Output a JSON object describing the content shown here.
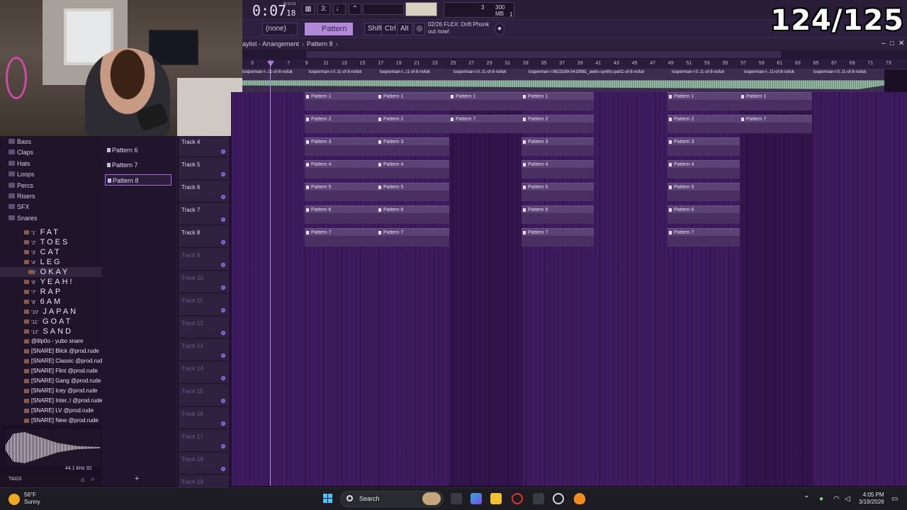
{
  "counter": "124/125",
  "toolbar": {
    "time_main": "0:07",
    "time_sub": "18",
    "time_label": "M:S:CS",
    "cpu_value": "3",
    "memory": "300 MB",
    "cpu_small": "1"
  },
  "bar2": {
    "none_label": "(none)",
    "pattern_label": "Pattern 8",
    "shift": "Shift",
    "ctrl": "Ctrl",
    "alt": "Alt",
    "news_line1": "02/26  FLEX: Drift Phonk",
    "news_line2": "out now!"
  },
  "playlist": {
    "title": "aylist - Arrangement",
    "current": "Pattern 8"
  },
  "ruler": [
    "3",
    "5",
    "7",
    "9",
    "11",
    "13",
    "15",
    "17",
    "19",
    "21",
    "23",
    "25",
    "27",
    "29",
    "31",
    "33",
    "35",
    "37",
    "39",
    "41",
    "43",
    "45",
    "47",
    "49",
    "51",
    "53",
    "55",
    "57",
    "59",
    "61",
    "63",
    "65",
    "67",
    "69",
    "71",
    "73"
  ],
  "audio_labels": [
    "looperman-l-..t1-of-8-nofuk",
    "looperman-l-0..t1-of-8-nofuk",
    "looperman-l-..t1-of-8-nofuk",
    "looperman-l-0..t1-of-8-nofuk",
    "looperman-l-0623169-0419981_awks-synths-part1-of-8-nofuk",
    "looperman-l-0..t1-of-8-nofuk",
    "looperman-l-..t1-of-8-nofuk",
    "looperman-l-0..t1-of-8-nofuk"
  ],
  "browser": {
    "folders": [
      "Bass",
      "Claps",
      "Hats",
      "Loops",
      "Percs",
      "Risers",
      "SFX",
      "Snares"
    ],
    "sounds": [
      {
        "num": "'1'",
        "name": "FAT"
      },
      {
        "num": "'2'",
        "name": "TOES"
      },
      {
        "num": "'3'",
        "name": "CAT"
      },
      {
        "num": "'4'",
        "name": "LEG"
      },
      {
        "num": "'5'",
        "name": "OKAY"
      },
      {
        "num": "'6'",
        "name": "YEAH!"
      },
      {
        "num": "'7'",
        "name": "RAP"
      },
      {
        "num": "'8'",
        "name": "6AM"
      },
      {
        "num": "'10'",
        "name": "JAPAN"
      },
      {
        "num": "'11'",
        "name": "GOAT"
      },
      {
        "num": "'12'",
        "name": "SAND"
      }
    ],
    "samples": [
      "@lilp0o - yubo snare",
      "[SNARE] Blick @prod.rude",
      "[SNARE] Classic @prod.rude",
      "[SNARE] Flint @prod.rude",
      "[SNARE] Gang @prod.rude",
      "[SNARE] Icey @prod.rude",
      "[SNARE] Inter..l @prod.rude",
      "[SNARE] LV @prod.rude",
      "[SNARE] New @prod.rude"
    ],
    "sample_info": "44.1 kHz 32",
    "tags": "TAGS"
  },
  "picker": [
    "Pattern 6",
    "Pattern 7",
    "Pattern 8"
  ],
  "tracks": [
    "Track 4",
    "Track 5",
    "Track 6",
    "Track 7",
    "Track 8",
    "Track 9",
    "Track 10",
    "Track 11",
    "Track 12",
    "Track 13",
    "Track 14",
    "Track 15",
    "Track 16",
    "Track 17",
    "Track 18",
    "Track 19"
  ],
  "clips": {
    "row1": "Pattern 1",
    "row2a": "Pattern 2",
    "row2b": "Pattern 7",
    "row3": "Pattern 3",
    "row4": "Pattern 4",
    "row5": "Pattern 5",
    "row6": "Pattern 6",
    "row7": "Pattern 7"
  },
  "taskbar": {
    "temp": "56°F",
    "weather": "Sunny",
    "search": "Search",
    "time": "4:05 PM",
    "date": "3/19/2026"
  }
}
